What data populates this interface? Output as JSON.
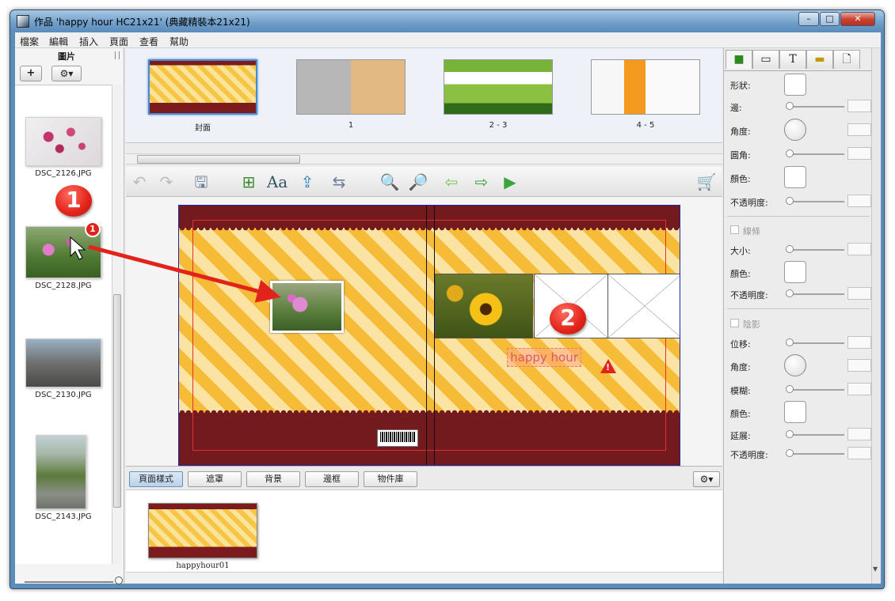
{
  "window": {
    "title": "作品 'happy hour HC21x21' (典藏精裝本21x21)",
    "min": "–",
    "max": "□",
    "close": "✕"
  },
  "menu": [
    "檔案",
    "編輯",
    "插入",
    "頁面",
    "查看",
    "幫助"
  ],
  "left_panel": {
    "title": "圖片",
    "add_label": "+",
    "gear_label": "⚙▾",
    "photos": [
      {
        "name": "DSC_2126.JPG"
      },
      {
        "name": "DSC_2128.JPG"
      },
      {
        "name": "DSC_2130.JPG"
      },
      {
        "name": "DSC_2143.JPG"
      }
    ],
    "selected_badge": "1"
  },
  "spreads": [
    {
      "label": "封面"
    },
    {
      "label": "1"
    },
    {
      "label": "2 - 3"
    },
    {
      "label": "4 - 5"
    }
  ],
  "toolbar": {
    "undo": "↶",
    "redo": "↷",
    "save": "🖫",
    "add_photo": "⊞",
    "add_text": "Aa",
    "autofill": "⇪",
    "flip": "⇆",
    "zoom_out": "🔍",
    "zoom_in": "🔎",
    "prev": "⇦",
    "next": "⇨",
    "play": "▶",
    "cart": "🛒"
  },
  "canvas": {
    "text_box": "happy hour"
  },
  "annotations": {
    "callout1": "1",
    "callout2": "2",
    "warn": "!"
  },
  "tabs": [
    "頁面樣式",
    "遮罩",
    "背景",
    "邊框",
    "物件庫"
  ],
  "tab_gear": "⚙▾",
  "layouts": [
    {
      "label": "happyhour01"
    }
  ],
  "right_panel": {
    "tabs": [
      "■",
      "▭",
      "T",
      "▬",
      "🗋"
    ],
    "props": {
      "shape": "形狀:",
      "edge": "邊:",
      "angle": "角度:",
      "corner": "圓角:",
      "color": "顏色:",
      "opacity": "不透明度:",
      "stroke_section": "線條",
      "size": "大小:",
      "stroke_color": "顏色:",
      "stroke_opacity": "不透明度:",
      "shadow_section": "陰影",
      "offset": "位移:",
      "shadow_angle": "角度:",
      "blur": "模糊:",
      "shadow_color": "顏色:",
      "spread": "延展:",
      "shadow_opacity": "不透明度:"
    }
  }
}
